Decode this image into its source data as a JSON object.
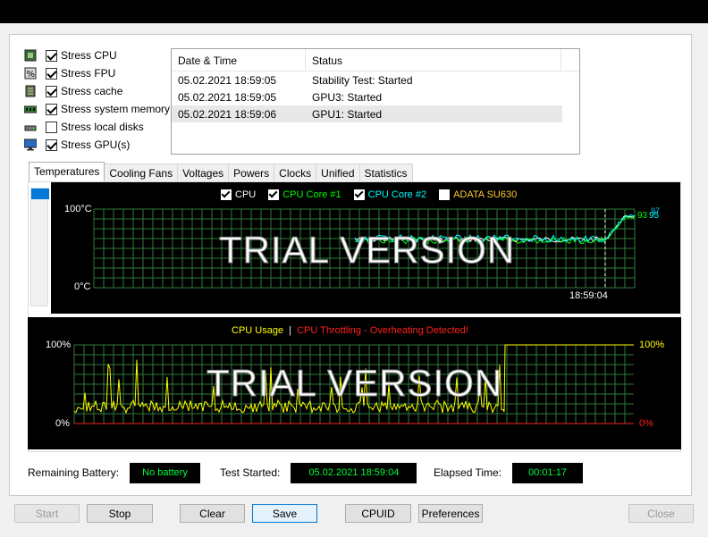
{
  "stress_options": [
    {
      "label": "Stress CPU",
      "checked": true,
      "icon": "cpu-icon"
    },
    {
      "label": "Stress FPU",
      "checked": true,
      "icon": "fpu-icon"
    },
    {
      "label": "Stress cache",
      "checked": true,
      "icon": "cache-icon"
    },
    {
      "label": "Stress system memory",
      "checked": true,
      "icon": "memory-icon"
    },
    {
      "label": "Stress local disks",
      "checked": false,
      "icon": "disk-icon"
    },
    {
      "label": "Stress GPU(s)",
      "checked": true,
      "icon": "gpu-icon"
    }
  ],
  "log": {
    "headers": [
      "Date & Time",
      "Status"
    ],
    "rows": [
      {
        "time": "05.02.2021 18:59:05",
        "status": "Stability Test: Started"
      },
      {
        "time": "05.02.2021 18:59:05",
        "status": "GPU3: Started"
      },
      {
        "time": "05.02.2021 18:59:06",
        "status": "GPU1: Started"
      }
    ]
  },
  "tabs": [
    "Temperatures",
    "Cooling Fans",
    "Voltages",
    "Powers",
    "Clocks",
    "Unified",
    "Statistics"
  ],
  "temp_graph": {
    "legend": [
      {
        "label": "CPU",
        "checked": true,
        "color": "#ffffff"
      },
      {
        "label": "CPU Core #1",
        "checked": true,
        "color": "#00ff00"
      },
      {
        "label": "CPU Core #2",
        "checked": true,
        "color": "#00ffff"
      },
      {
        "label": "ADATA SU630",
        "checked": false,
        "color": "#ffcc33"
      }
    ],
    "y_top": "100°C",
    "y_bottom": "0°C",
    "time_label": "18:59:04",
    "val_a": "93",
    "val_b": "95",
    "val_c": "97",
    "watermark": "TRIAL VERSION"
  },
  "usage_graph": {
    "title_usage": "CPU Usage",
    "separator": "|",
    "title_throttle": "CPU Throttling - Overheating Detected!",
    "left_top": "100%",
    "left_bottom": "0%",
    "right_top": "100%",
    "right_bottom": "0%",
    "watermark": "TRIAL VERSION"
  },
  "status": {
    "battery_label": "Remaining Battery:",
    "battery_value": "No battery",
    "started_label": "Test Started:",
    "started_value": "05.02.2021 18:59:04",
    "elapsed_label": "Elapsed Time:",
    "elapsed_value": "00:01:17"
  },
  "buttons": {
    "start": "Start",
    "stop": "Stop",
    "clear": "Clear",
    "save": "Save",
    "cpuid": "CPUID",
    "preferences": "Preferences",
    "close": "Close"
  }
}
